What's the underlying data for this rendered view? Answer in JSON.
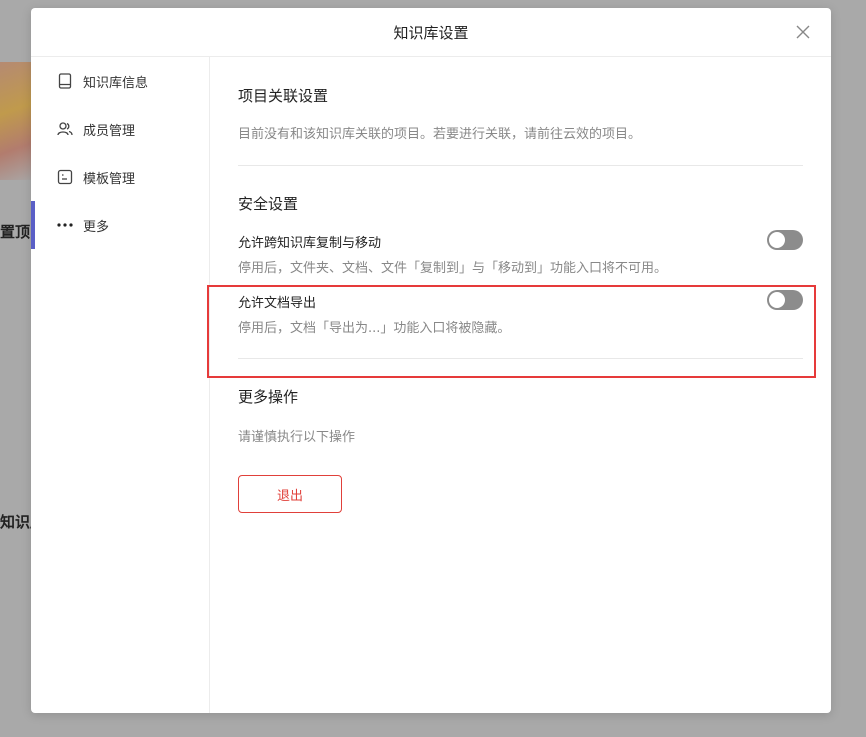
{
  "background": {
    "text_1": "置顶内",
    "text_2": "知识库"
  },
  "modal": {
    "title": "知识库设置"
  },
  "sidebar": {
    "items": [
      {
        "label": "知识库信息",
        "icon": "book-icon"
      },
      {
        "label": "成员管理",
        "icon": "users-icon"
      },
      {
        "label": "模板管理",
        "icon": "template-icon"
      },
      {
        "label": "更多",
        "icon": "more-dots-icon",
        "active": true
      }
    ]
  },
  "project": {
    "title": "项目关联设置",
    "desc": "目前没有和该知识库关联的项目。若要进行关联，请前往云效的项目。"
  },
  "security": {
    "title": "安全设置",
    "copy_move": {
      "label": "允许跨知识库复制与移动",
      "desc": "停用后，文件夹、文档、文件「复制到」与「移动到」功能入口将不可用。",
      "enabled": false
    },
    "export": {
      "label": "允许文档导出",
      "desc": "停用后，文档「导出为...」功能入口将被隐藏。",
      "enabled": false
    }
  },
  "more_ops": {
    "title": "更多操作",
    "desc": "请谨慎执行以下操作",
    "exit_label": "退出"
  },
  "colors": {
    "accent": "#5a5fc6",
    "danger": "#e0403a",
    "highlight": "#e63a3a",
    "toggle_off": "#8c8c8c"
  }
}
